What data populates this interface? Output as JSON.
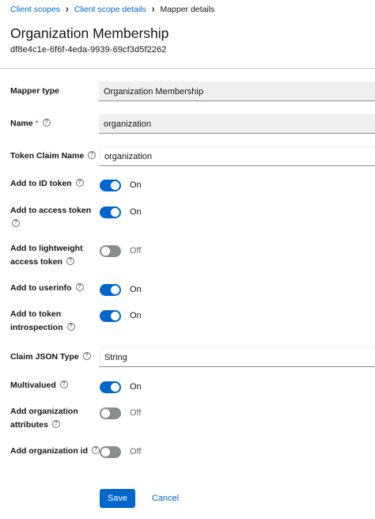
{
  "breadcrumb": {
    "items": [
      "Client scopes",
      "Client scope details"
    ],
    "current": "Mapper details"
  },
  "header": {
    "title": "Organization Membership",
    "subtitle": "df8e4c1e-6f6f-4eda-9939-69cf3d5f2262"
  },
  "form": {
    "mapper_type": {
      "label": "Mapper type",
      "value": "Organization Membership"
    },
    "name": {
      "label": "Name",
      "required_marker": "*",
      "value": "organization"
    },
    "token_claim_name": {
      "label": "Token Claim Name",
      "value": "organization"
    },
    "add_to_id_token": {
      "label": "Add to ID token",
      "state": "On",
      "on": true
    },
    "add_to_access_token": {
      "label_line1": "Add to access token",
      "state": "On",
      "on": true
    },
    "add_to_lightweight": {
      "label_line1": "Add to lightweight",
      "label_line2": "access token",
      "state": "Off",
      "on": false
    },
    "add_to_userinfo": {
      "label": "Add to userinfo",
      "state": "On",
      "on": true
    },
    "add_to_introspection": {
      "label_line1": "Add to token",
      "label_line2": "introspection",
      "state": "On",
      "on": true
    },
    "claim_json_type": {
      "label": "Claim JSON Type",
      "value": "String"
    },
    "multivalued": {
      "label": "Multivalued",
      "state": "On",
      "on": true
    },
    "add_org_attributes": {
      "label_line1": "Add organization",
      "label_line2": "attributes",
      "state": "Off",
      "on": false
    },
    "add_org_id": {
      "label": "Add organization id",
      "state": "Off",
      "on": false
    }
  },
  "actions": {
    "save_label": "Save",
    "cancel_label": "Cancel"
  },
  "colors": {
    "primary": "#0066cc",
    "toggle_off": "#8a8d90",
    "required": "#c9190b",
    "readonly_bg": "#f0f0f0"
  },
  "icons": {
    "help": "question-circle-icon",
    "separator": "chevron-right-icon"
  }
}
